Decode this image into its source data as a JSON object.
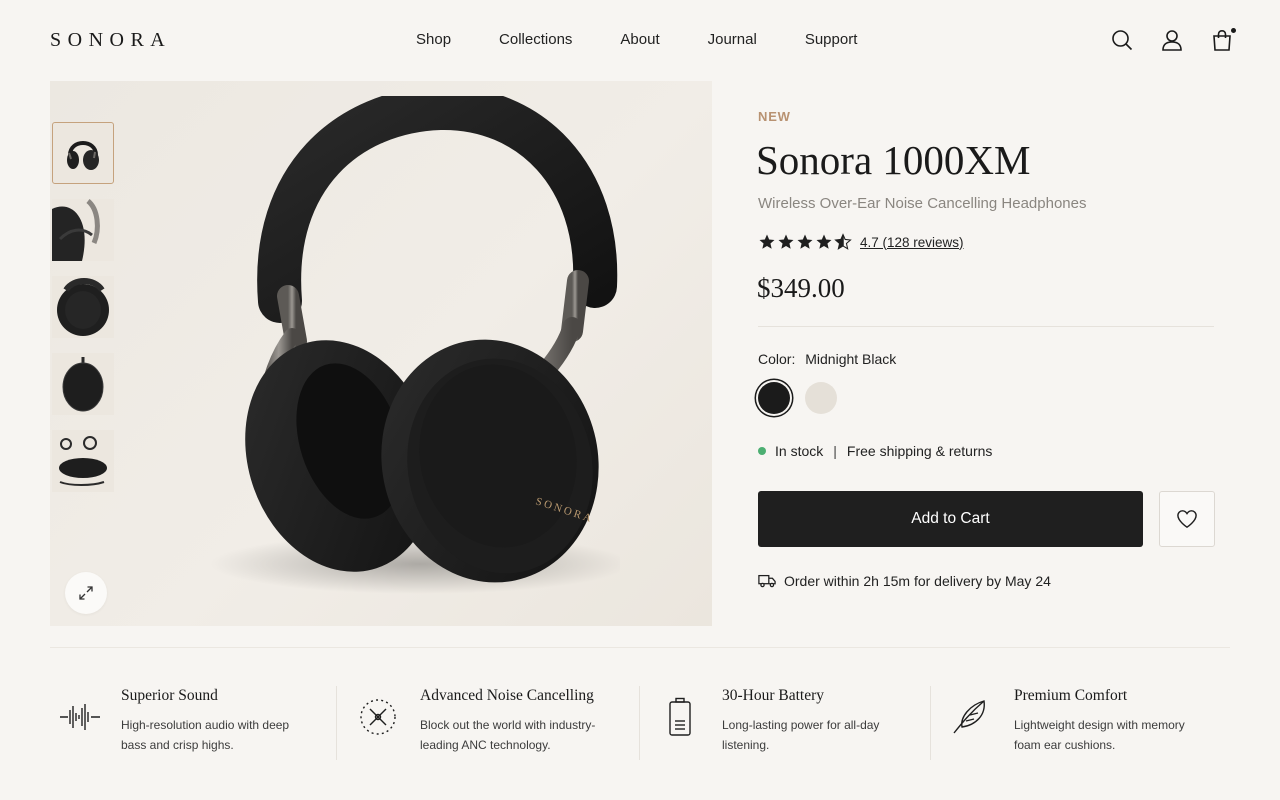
{
  "brand": {
    "logo": "SONORA"
  },
  "nav": {
    "items": [
      "Shop",
      "Collections",
      "About",
      "Journal",
      "Support"
    ]
  },
  "header_icons": [
    "search-icon",
    "user-icon",
    "cart-icon"
  ],
  "gallery": {
    "thumbnails": [
      "headphones-front",
      "headphones-detail",
      "headphones-folded",
      "carrying-case",
      "accessories"
    ],
    "active_thumbnail": 0,
    "expand_icon": "expand-icon"
  },
  "product": {
    "badge": "NEW",
    "title": "Sonora 1000XM",
    "subtitle": "Wireless Over-Ear Noise Cancelling Headphones",
    "rating": 4.7,
    "rating_text": "4.7 (128 reviews)",
    "price": "$349.00",
    "color_label": "Color:",
    "color_value": "Midnight Black",
    "colors": [
      {
        "name": "Midnight Black",
        "hex": "#1b1b1b",
        "selected": true
      },
      {
        "name": "Cream",
        "hex": "#e5e0d8",
        "selected": false
      }
    ],
    "stock_text": "In stock",
    "stock_color": "#4caf72",
    "separator": "|",
    "shipping_text": "Free shipping & returns",
    "add_to_cart": "Add to Cart",
    "delivery_text": "Order within 2h 15m for delivery by May 24"
  },
  "features": [
    {
      "icon": "waveform-icon",
      "title": "Superior Sound",
      "desc_line1": "High-resolution audio with deep",
      "desc_line2": "bass and crisp highs."
    },
    {
      "icon": "noise-cancel-icon",
      "title": "Advanced Noise Cancelling",
      "desc_line1": "Block out the world with industry-",
      "desc_line2": "leading ANC technology."
    },
    {
      "icon": "battery-icon",
      "title": "30-Hour Battery",
      "desc_line1": "Long-lasting power for all-day",
      "desc_line2": "listening."
    },
    {
      "icon": "feather-icon",
      "title": "Premium Comfort",
      "desc_line1": "Lightweight design with memory",
      "desc_line2": "foam ear cushions."
    }
  ],
  "colors": {
    "accent": "#b89272",
    "button": "#1f1f1f",
    "background": "#f7f5f2"
  }
}
